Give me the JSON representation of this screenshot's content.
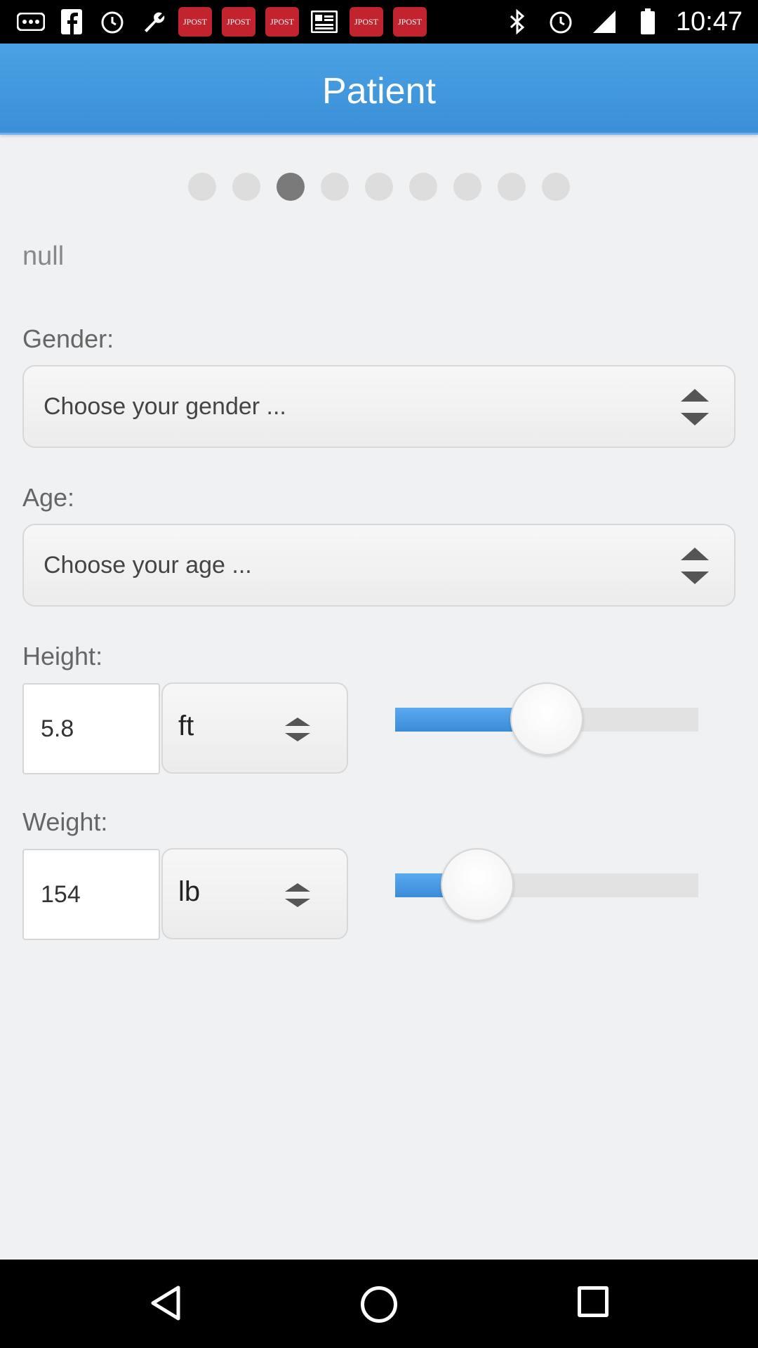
{
  "status_bar": {
    "left_icons": [
      "more-icon",
      "facebook-icon",
      "alarm-icon",
      "wrench-icon"
    ],
    "jpost_badges": [
      "JPOST",
      "JPOST",
      "JPOST"
    ],
    "news_icon": "newspaper-icon",
    "jpost_badges_2": [
      "JPOST",
      "JPOST"
    ],
    "right_icons": [
      "bluetooth-icon",
      "alarm-icon",
      "signal-icon",
      "battery-icon"
    ],
    "time": "10:47"
  },
  "header": {
    "title": "Patient"
  },
  "pager": {
    "count": 9,
    "active_index": 2
  },
  "main": {
    "name_text": "null",
    "gender": {
      "label": "Gender:",
      "placeholder": "Choose your gender ..."
    },
    "age": {
      "label": "Age:",
      "placeholder": "Choose your age ..."
    },
    "height": {
      "label": "Height:",
      "value": "5.8",
      "unit": "ft",
      "slider_fraction": 0.5
    },
    "weight": {
      "label": "Weight:",
      "value": "154",
      "unit": "lb",
      "slider_fraction": 0.27
    }
  },
  "colors": {
    "accent": "#3b8fd6",
    "background": "#eff1f3"
  }
}
